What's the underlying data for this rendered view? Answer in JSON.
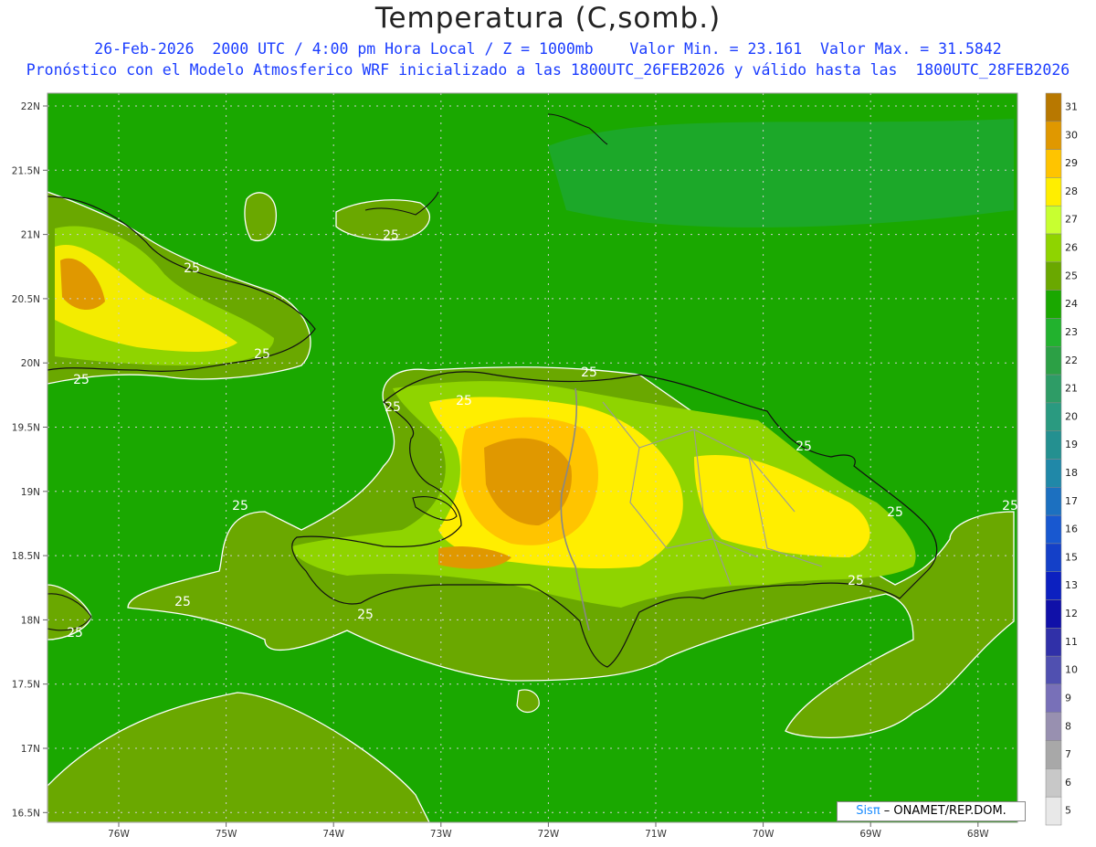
{
  "title": "Temperatura (C,somb.)",
  "subtitle_line1": "26-Feb-2026  2000 UTC / 4:00 pm Hora Local / Z = 1000mb    Valor Min. = 23.161  Valor Max. = 31.5842",
  "subtitle_line2": "Pronóstico con el Modelo Atmosferico WRF inicializado a las 1800UTC_26FEB2026 y válido hasta las  1800UTC_28FEB2026",
  "credit": {
    "brand": "Sisπ",
    "rest": " – ONAMET/REP.DOM."
  },
  "lat_labels": [
    "22N",
    "21.5N",
    "21N",
    "20.5N",
    "20N",
    "19.5N",
    "19N",
    "18.5N",
    "18N",
    "17.5N",
    "17N",
    "16.5N"
  ],
  "lon_labels": [
    "76W",
    "75W",
    "74W",
    "73W",
    "72W",
    "71W",
    "70W",
    "69W",
    "68W"
  ],
  "contour_labels": [
    "25",
    "25",
    "25",
    "25",
    "25",
    "25",
    "25",
    "25",
    "25",
    "25",
    "25",
    "25",
    "25",
    "25",
    "25"
  ],
  "colorbar": {
    "labels": [
      "31",
      "30",
      "29",
      "28",
      "27",
      "26",
      "25",
      "24",
      "23",
      "22",
      "21",
      "20",
      "19",
      "18",
      "17",
      "16",
      "15",
      "13",
      "12",
      "11",
      "10",
      "9",
      "8",
      "7",
      "6",
      "5"
    ],
    "colors": [
      "#b87800",
      "#e09800",
      "#ffc400",
      "#ffee00",
      "#c8ff30",
      "#8fd400",
      "#6aa800",
      "#1aa800",
      "#22b22e",
      "#2ca045",
      "#2e9c66",
      "#2a9a80",
      "#249090",
      "#2088a8",
      "#1c70c0",
      "#1858d0",
      "#1440c8",
      "#0c20c0",
      "#1010a8",
      "#3030a8",
      "#5050b0",
      "#7870b8",
      "#9890b0",
      "#a8a8a8",
      "#c8c8c8",
      "#e8e8e8"
    ]
  },
  "colors": {
    "ocean": "#1aa800",
    "land_warm": "#6aa800",
    "title_text": "#222222",
    "subtitle_text": "#1a3cff"
  }
}
